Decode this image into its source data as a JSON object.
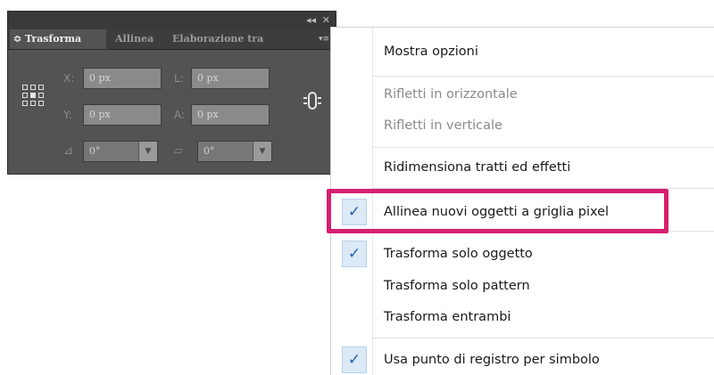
{
  "panel": {
    "topbar": {
      "collapse_glyph": "◂◂",
      "close_glyph": "✕"
    },
    "tabs": [
      {
        "label": "≎ Trasforma",
        "active": true
      },
      {
        "label": "Allinea",
        "active": false
      },
      {
        "label": "Elaborazione tra",
        "active": false
      }
    ],
    "menu_button_glyph": "▾≡",
    "fields": {
      "x": {
        "label": "X:",
        "value": "0 px"
      },
      "y": {
        "label": "Y:",
        "value": "0 px"
      },
      "w": {
        "label": "L:",
        "value": "0 px"
      },
      "h": {
        "label": "A:",
        "value": "0 px"
      },
      "rotate": {
        "icon": "rotate-angle-icon",
        "glyph": "⊿",
        "value": "0°"
      },
      "shear": {
        "icon": "shear-angle-icon",
        "glyph": "▱",
        "value": "0°"
      }
    },
    "reference_point_selected": "center",
    "constrain_icon": "link-proportions-icon"
  },
  "menu": {
    "items": [
      {
        "label": "Mostra opzioni",
        "disabled": false,
        "checked": false
      },
      {
        "label": "Rifletti in orizzontale",
        "disabled": true,
        "checked": false
      },
      {
        "label": "Rifletti in verticale",
        "disabled": true,
        "checked": false
      },
      {
        "label": "Ridimensiona tratti ed effetti",
        "disabled": false,
        "checked": false
      },
      {
        "label": "Allinea nuovi oggetti a griglia pixel",
        "disabled": false,
        "checked": true,
        "highlighted": true
      },
      {
        "label": "Trasforma solo oggetto",
        "disabled": false,
        "checked": true
      },
      {
        "label": "Trasforma solo pattern",
        "disabled": false,
        "checked": false
      },
      {
        "label": "Trasforma entrambi",
        "disabled": false,
        "checked": false
      },
      {
        "label": "Usa punto di registro per simbolo",
        "disabled": false,
        "checked": true
      }
    ],
    "check_glyph": "✓"
  },
  "colors": {
    "panel_bg": "#535353",
    "highlight_border": "#d6206f",
    "check_color": "#1f5fae"
  }
}
